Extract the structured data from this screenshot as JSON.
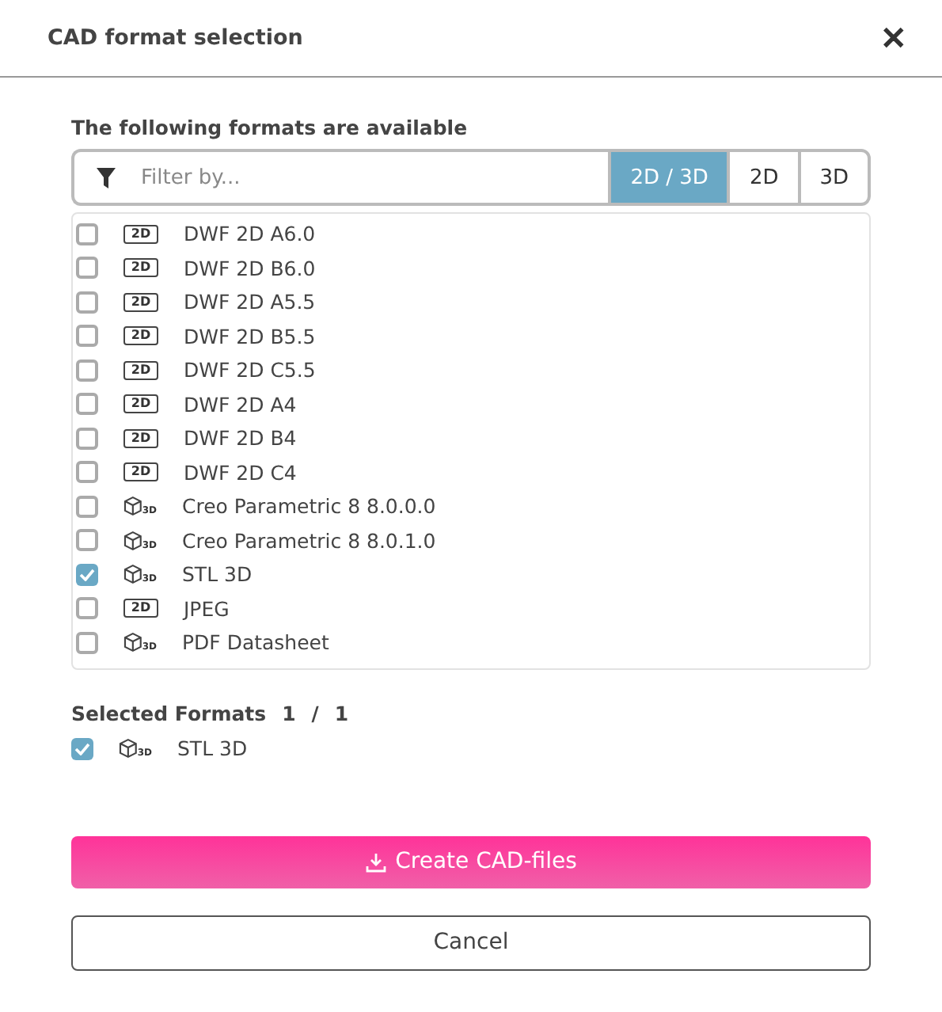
{
  "dialog": {
    "title": "CAD format selection",
    "close": "✕"
  },
  "available": {
    "heading": "The following formats are available",
    "filter": {
      "placeholder": "Filter by..."
    },
    "segments": [
      {
        "label": "2D / 3D",
        "selected": true
      },
      {
        "label": "2D",
        "selected": false
      },
      {
        "label": "3D",
        "selected": false
      }
    ],
    "formats": [
      {
        "kind": "drawing",
        "badge": "2D",
        "name": "DWF 2D A6.0",
        "checked": false
      },
      {
        "kind": "drawing",
        "badge": "2D",
        "name": "DWF 2D B6.0",
        "checked": false
      },
      {
        "kind": "drawing",
        "badge": "2D",
        "name": "DWF 2D A5.5",
        "checked": false
      },
      {
        "kind": "drawing",
        "badge": "2D",
        "name": "DWF 2D B5.5",
        "checked": false
      },
      {
        "kind": "drawing",
        "badge": "2D",
        "name": "DWF 2D C5.5",
        "checked": false
      },
      {
        "kind": "drawing",
        "badge": "2D",
        "name": "DWF 2D A4",
        "checked": false
      },
      {
        "kind": "drawing",
        "badge": "2D",
        "name": "DWF 2D B4",
        "checked": false
      },
      {
        "kind": "drawing",
        "badge": "2D",
        "name": "DWF 2D C4",
        "checked": false
      },
      {
        "kind": "model",
        "badge": "3D",
        "name": "Creo Parametric 8 8.0.0.0",
        "checked": false
      },
      {
        "kind": "model",
        "badge": "3D",
        "name": "Creo Parametric 8 8.0.1.0",
        "checked": false
      },
      {
        "kind": "model",
        "badge": "3D",
        "name": "STL 3D",
        "checked": true
      },
      {
        "kind": "drawing",
        "badge": "2D",
        "name": "JPEG",
        "checked": false
      },
      {
        "kind": "model",
        "badge": "3D",
        "name": "PDF Datasheet",
        "checked": false
      }
    ]
  },
  "selected": {
    "heading": "Selected Formats",
    "count": "1",
    "separator": "/",
    "total": "1",
    "items": [
      {
        "kind": "model",
        "badge": "3D",
        "name": "STL 3D",
        "checked": true
      }
    ]
  },
  "buttons": {
    "create": "Create CAD-files",
    "cancel": "Cancel"
  }
}
